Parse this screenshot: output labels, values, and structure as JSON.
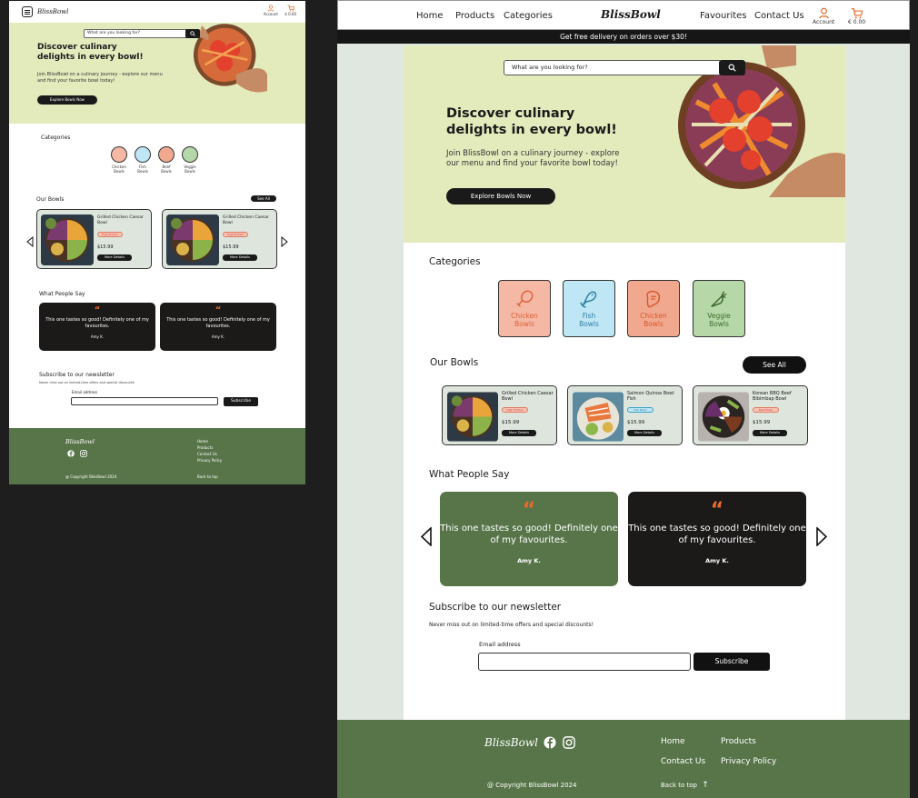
{
  "brand": {
    "logo": "BlissBowl"
  },
  "colors": {
    "hero_bg": "#e3ebbd",
    "footer_bg": "#577549",
    "accent": "#e8692e",
    "dark": "#1a1a1a",
    "card_bg": "#dde5dd"
  },
  "nav": {
    "home": "Home",
    "products": "Products",
    "categories": "Categories",
    "favourites": "Favourites",
    "contact": "Contact Us",
    "account": "Account",
    "cart_total_desktop": "€ 0.00",
    "cart_total_mobile": "$ 0.00"
  },
  "promo": "Get free delivery on orders over $30!",
  "search": {
    "placeholder": "What are you looking for?"
  },
  "hero": {
    "title": "Discover culinary delights in every bowl!",
    "subtitle": "Join BlissBowl on a culinary journey - explore our menu and find your favorite bowl today!",
    "button": "Explore Bowls Now"
  },
  "categories": {
    "title": "Categories",
    "items": [
      {
        "line1": "Chicken",
        "line2": "Bowls",
        "icon": "drumstick-icon",
        "bg": "#f4b8a4",
        "fg": "#e0613c"
      },
      {
        "line1": "Fish",
        "line2": "Bowls",
        "icon": "fish-icon",
        "bg": "#bfe6f4",
        "fg": "#2e7fa3"
      },
      {
        "line1": "Chicken",
        "line2": "Bowls",
        "icon": "steak-icon",
        "bg": "#f0a98f",
        "fg": "#d9572f"
      },
      {
        "line1": "Veggie",
        "line2": "Bowls",
        "icon": "carrot-icon",
        "bg": "#b6d8a8",
        "fg": "#3d6b2c"
      }
    ],
    "mobile_items": [
      {
        "line1": "Chicken",
        "line2": "Bowls"
      },
      {
        "line1": "Fish",
        "line2": "Bowls"
      },
      {
        "line1": "Beef",
        "line2": "Bowls"
      },
      {
        "line1": "Veggie",
        "line2": "Bowls"
      }
    ]
  },
  "bowls": {
    "title": "Our Bowls",
    "see_all": "See All",
    "items": [
      {
        "name": "Grilled Chicken Caesar Bowl",
        "tag": "High Protein",
        "price": "$15.99",
        "button": "More Details"
      },
      {
        "name": "Salmon Quinoa Bowl Fish",
        "tag": "Fish Bowl",
        "price": "$15.99",
        "button": "More Details"
      },
      {
        "name": "Korean BBQ Beef Bibimbap Bowl",
        "tag": "Beef Bowl",
        "price": "$15.99",
        "button": "More Details"
      }
    ],
    "mobile_items": [
      {
        "name": "Grilled Chicken Caesar Bowl",
        "tag": "High Protein",
        "price": "$15.99",
        "button": "More Details"
      },
      {
        "name": "Grilled Chicken Caesar Bowl",
        "tag": "High Protein",
        "price": "$15.99",
        "button": "More Details"
      }
    ]
  },
  "testimonials": {
    "title": "What People Say",
    "quote_mark": "“",
    "items": [
      {
        "text": "This one tastes so good! Definitely one of my favourites.",
        "author": "Amy K."
      },
      {
        "text": "This one tastes so good! Definitely one of my favourites.",
        "author": "Amy K."
      }
    ]
  },
  "newsletter": {
    "title": "Subscribe to our newsletter",
    "note": "Never miss out on limited-time offers and special discounts!",
    "email_label": "Email address",
    "button": "Subscribe"
  },
  "footer": {
    "links": [
      "Home",
      "Products",
      "Contact Us",
      "Privacy Policy"
    ],
    "copyright": "@ Copyright BlissBowl 2024",
    "back_to_top": "Back to top"
  }
}
